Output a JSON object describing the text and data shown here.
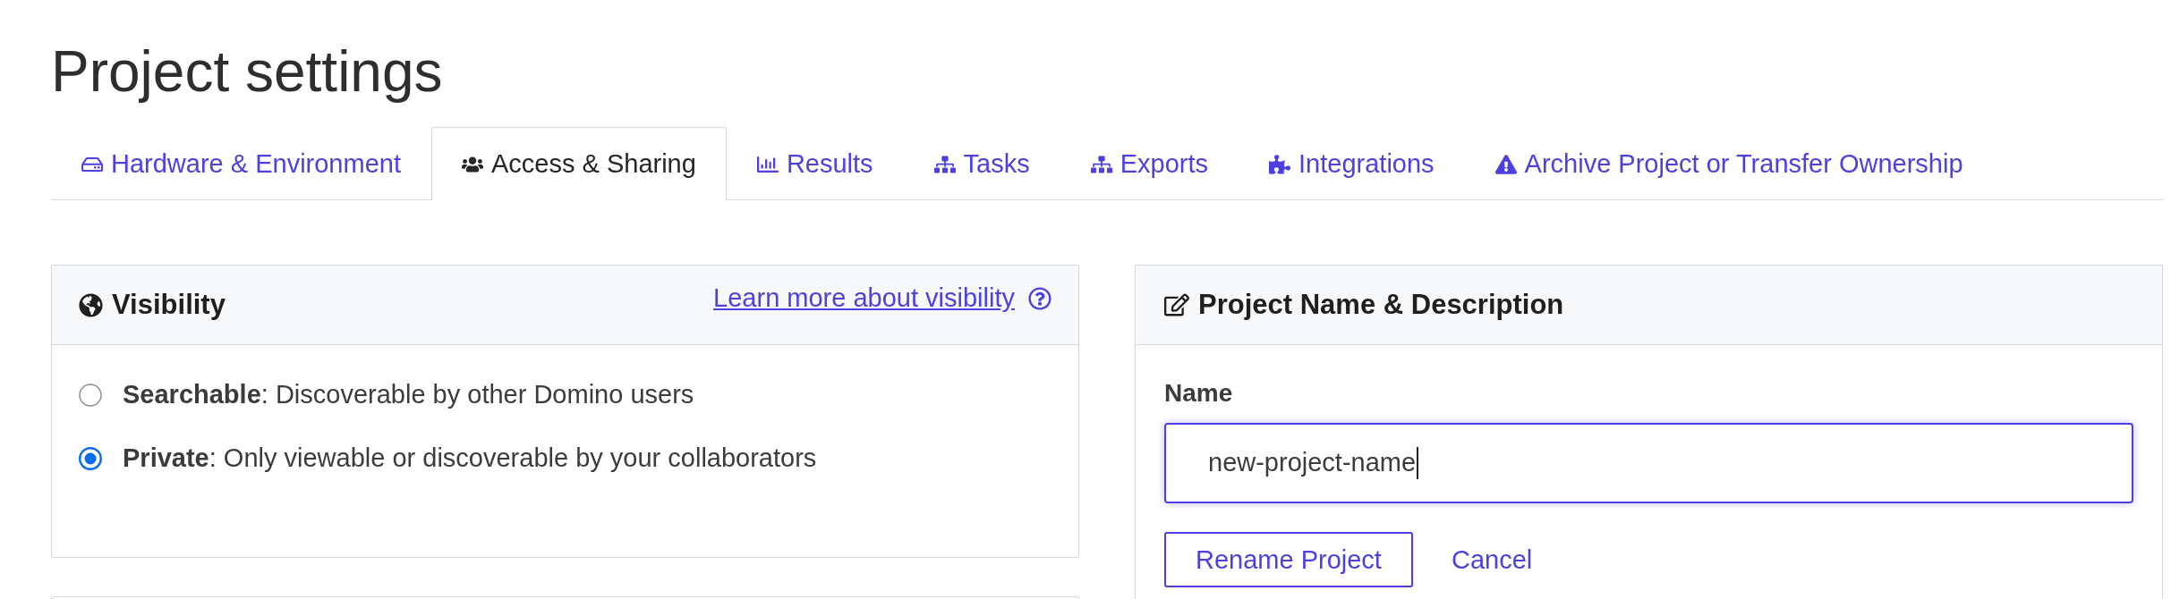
{
  "page": {
    "title": "Project settings"
  },
  "tabs": [
    {
      "label": "Hardware & Environment",
      "selected": false
    },
    {
      "label": "Access & Sharing",
      "selected": true
    },
    {
      "label": "Results",
      "selected": false
    },
    {
      "label": "Tasks",
      "selected": false
    },
    {
      "label": "Exports",
      "selected": false
    },
    {
      "label": "Integrations",
      "selected": false
    },
    {
      "label": "Archive Project or Transfer Ownership",
      "selected": false
    }
  ],
  "visibility_panel": {
    "title": "Visibility",
    "help_link": "Learn more about visibility",
    "options": [
      {
        "text": "**Searchable**: Discoverable by other Domino users",
        "selected": false
      },
      {
        "text": "**Private**: Only viewable or discoverable by your collaborators",
        "selected": true
      }
    ]
  },
  "name_panel": {
    "title": "Project Name & Description",
    "name_field": {
      "label": "Name",
      "value": "new-project-name"
    },
    "buttons": [
      {
        "label": "Rename Project",
        "kind": "outlined"
      },
      {
        "label": "Cancel",
        "kind": "link"
      }
    ]
  }
}
